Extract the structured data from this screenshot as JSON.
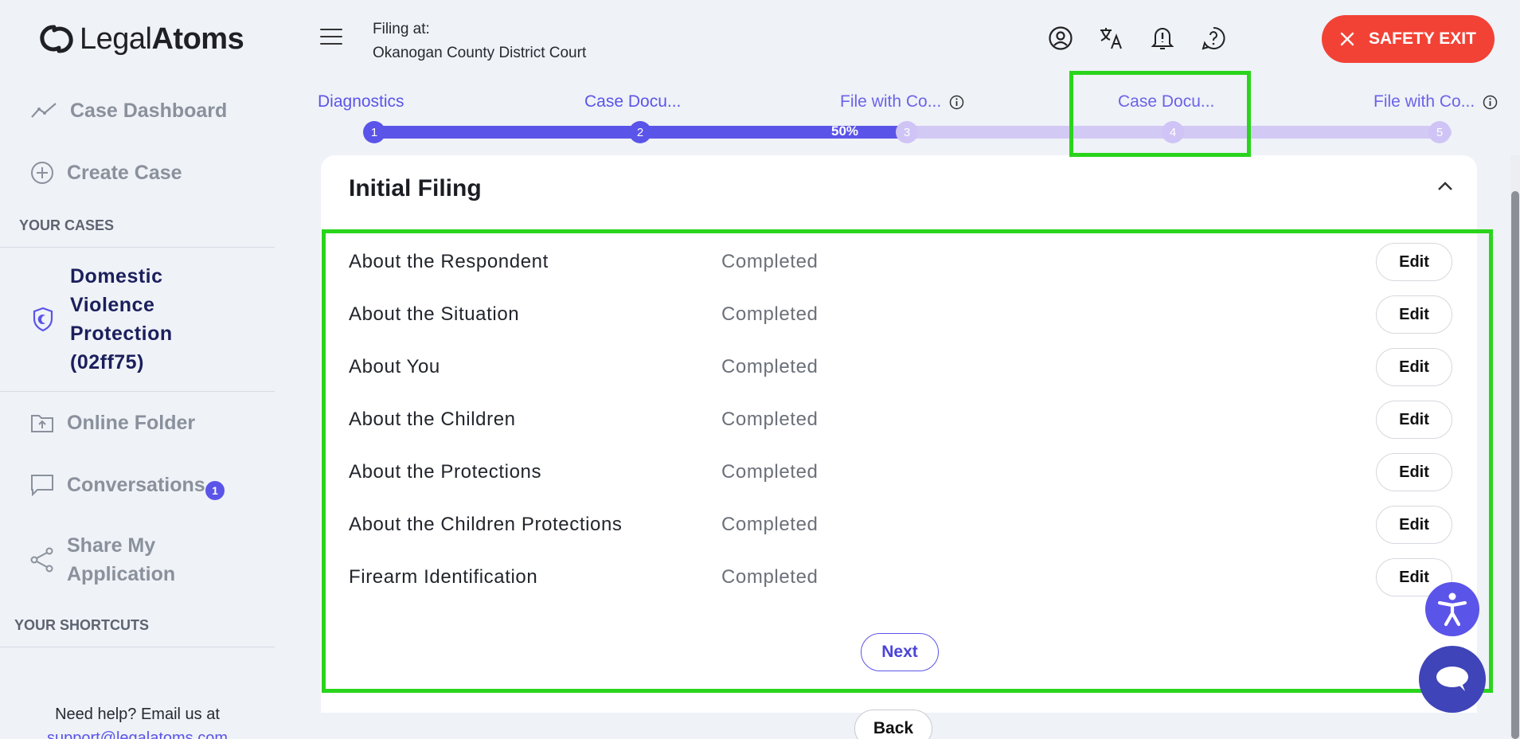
{
  "app": {
    "logo_light": "Legal",
    "logo_bold": "Atoms"
  },
  "header": {
    "filing_label": "Filing at:",
    "filing_court": "Okanogan County District Court",
    "safety_exit": "SAFETY EXIT",
    "icons": [
      "user-icon",
      "translate-icon",
      "notification-icon",
      "help-icon"
    ]
  },
  "sidebar": {
    "dashboard": "Case Dashboard",
    "create_case": "Create Case",
    "your_cases": "YOUR CASES",
    "case_name": "Domestic Violence Protection (02ff75)",
    "online_folder": "Online Folder",
    "conversations": "Conversations",
    "conversations_badge": "1",
    "share_line1": "Share My",
    "share_line2": "Application",
    "your_shortcuts": "YOUR SHORTCUTS",
    "help_text": "Need help? Email us at",
    "help_email": "support@legalatoms.com"
  },
  "stepper": {
    "progress": "50%",
    "steps": [
      {
        "label": "Diagnostics",
        "num": "1"
      },
      {
        "label": "Case Docu...",
        "num": "2"
      },
      {
        "label": "File with Co...",
        "num": "3"
      },
      {
        "label": "Case Docu...",
        "num": "4"
      },
      {
        "label": "File with Co...",
        "num": "5"
      }
    ]
  },
  "card": {
    "title": "Initial Filing",
    "rows": [
      {
        "name": "About the Respondent",
        "status": "Completed",
        "action": "Edit"
      },
      {
        "name": "About the Situation",
        "status": "Completed",
        "action": "Edit"
      },
      {
        "name": "About You",
        "status": "Completed",
        "action": "Edit"
      },
      {
        "name": "About the Children",
        "status": "Completed",
        "action": "Edit"
      },
      {
        "name": "About the Protections",
        "status": "Completed",
        "action": "Edit"
      },
      {
        "name": "About the Children Protections",
        "status": "Completed",
        "action": "Edit"
      },
      {
        "name": "Firearm Identification",
        "status": "Completed",
        "action": "Edit"
      }
    ],
    "next": "Next",
    "back": "Back"
  },
  "colors": {
    "accent": "#5b54e8",
    "danger": "#f24236",
    "highlight": "#2ad41c"
  }
}
